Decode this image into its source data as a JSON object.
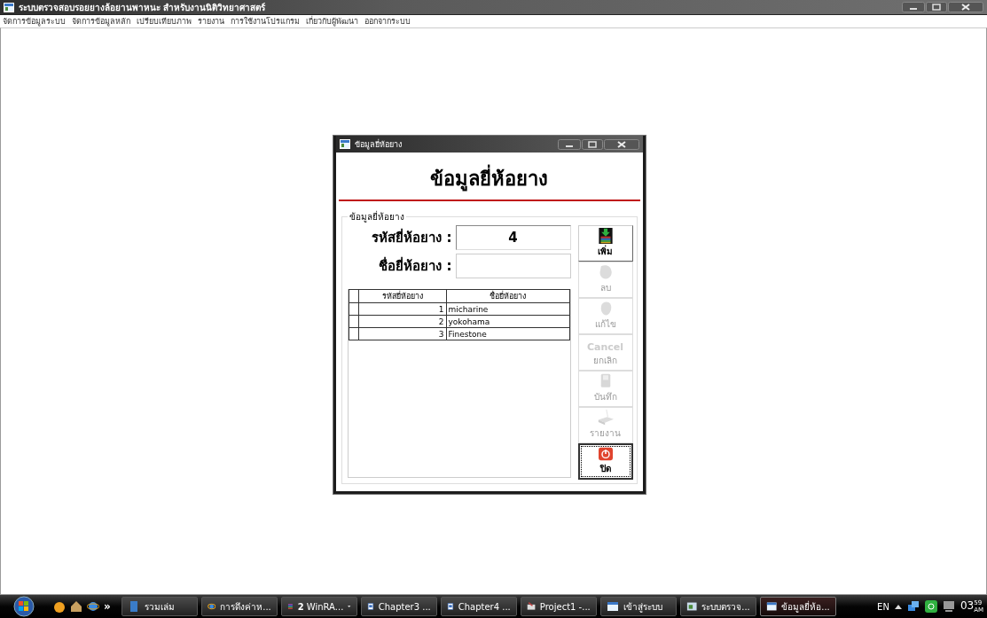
{
  "window": {
    "title": "ระบบตรวจสอบรอยยางล้อยานพาหนะ สำหรับงานนิติวิทยาศาสตร์"
  },
  "menu": [
    {
      "label": "จัดการข้อมูลระบบ"
    },
    {
      "label": "จัดการข้อมูลหลัก"
    },
    {
      "label": "เปรียบเทียบภาพ"
    },
    {
      "label": "รายงาน"
    },
    {
      "label": "การใช้งานโปรแกรม"
    },
    {
      "label": "เกี่ยวกับผู้พัฒนา"
    },
    {
      "label": "ออกจากระบบ"
    }
  ],
  "dialog": {
    "title": "ข้อมูลยี่ห้อยาง",
    "heading": "ข้อมูลยี่ห้อยาง",
    "group_label": "ข้อมูลยี่ห้อยาง",
    "fields": [
      {
        "label": "รหัสยี่ห้อยาง :",
        "value": "4"
      },
      {
        "label": "ชื่อยี่ห้อยาง :"
      }
    ],
    "table": {
      "columns": [
        "รหัสยี่ห้อยาง",
        "ชื่อยี่ห้อยาง"
      ],
      "rows": [
        [
          "1",
          "micharine"
        ],
        [
          "2",
          "yokohama"
        ],
        [
          "3",
          "Finestone"
        ]
      ]
    },
    "buttons": [
      {
        "kind": "add",
        "label": "เพิ่ม",
        "disabled": false,
        "focused": false
      },
      {
        "kind": "delete",
        "label": "ลบ",
        "disabled": true,
        "focused": false
      },
      {
        "kind": "edit",
        "label": "แก้ไข",
        "disabled": true,
        "focused": false
      },
      {
        "kind": "cancel",
        "caption": "Cancel",
        "label": "ยกเลิก",
        "disabled": true,
        "focused": false
      },
      {
        "kind": "save",
        "label": "บันทึก",
        "disabled": true,
        "focused": false
      },
      {
        "kind": "report",
        "label": "รายงาน",
        "disabled": true,
        "focused": false
      },
      {
        "kind": "close",
        "label": "ปิด",
        "disabled": false,
        "focused": true
      }
    ]
  },
  "taskbar": {
    "quick_launch_more": "»",
    "tasks": [
      {
        "kind": "folder",
        "label": "รวมเล่ม",
        "selected": false
      },
      {
        "kind": "browser",
        "label": "การดึงค่าห...",
        "selected": false
      },
      {
        "kind": "archive",
        "label": "**2** WinRA...",
        "selected": false,
        "grouped": true
      },
      {
        "kind": "document",
        "label": "Chapter3 ...",
        "selected": false
      },
      {
        "kind": "document",
        "label": "Chapter4 ...",
        "selected": false
      },
      {
        "kind": "project",
        "label": "Project1 -...",
        "selected": false
      },
      {
        "kind": "form",
        "label": "เข้าสู่ระบบ",
        "selected": false
      },
      {
        "kind": "app",
        "label": "ระบบตรวจ...",
        "selected": false
      },
      {
        "kind": "form",
        "label": "ข้อมูลยี่ห้อ...",
        "selected": true
      }
    ],
    "language": "EN",
    "clock": {
      "hour": "03",
      "minute": "59",
      "period": "AM"
    }
  }
}
